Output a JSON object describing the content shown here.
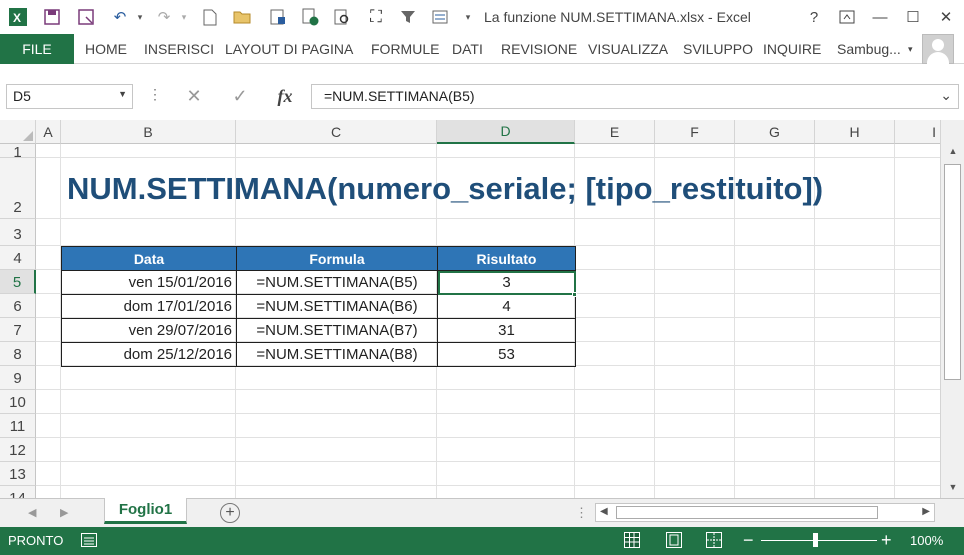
{
  "window": {
    "title": "La funzione NUM.SETTIMANA.xlsx - Excel",
    "help": "?",
    "minimize": "—",
    "restore": "☐",
    "close": "✕"
  },
  "quick_access": {
    "dropdown": "▾"
  },
  "ribbon": {
    "file_tab": "FILE",
    "tabs": [
      "HOME",
      "INSERISCI",
      "LAYOUT DI PAGINA",
      "FORMULE",
      "DATI",
      "REVISIONE",
      "VISUALIZZA",
      "SVILUPPO",
      "INQUIRE"
    ],
    "user": "Sambug...",
    "user_dropdown": "▾"
  },
  "formula_bar": {
    "name_box": "D5",
    "fx_label": "fx",
    "formula": "=NUM.SETTIMANA(B5)"
  },
  "grid": {
    "columns": [
      "A",
      "B",
      "C",
      "D",
      "E",
      "F",
      "G",
      "H",
      "I"
    ],
    "rows": [
      "1",
      "2",
      "3",
      "4",
      "5",
      "6",
      "7",
      "8",
      "9",
      "10",
      "11",
      "12",
      "13",
      "14"
    ],
    "selected_col": "D",
    "selected_row": "5"
  },
  "sheet": {
    "title": "NUM.SETTIMANA(numero_seriale; [tipo_restituito])",
    "table": {
      "headers": [
        "Data",
        "Formula",
        "Risultato"
      ],
      "rows": [
        {
          "data": "ven 15/01/2016",
          "formula": "=NUM.SETTIMANA(B5)",
          "risultato": "3"
        },
        {
          "data": "dom 17/01/2016",
          "formula": "=NUM.SETTIMANA(B6)",
          "risultato": "4"
        },
        {
          "data": "ven 29/07/2016",
          "formula": "=NUM.SETTIMANA(B7)",
          "risultato": "31"
        },
        {
          "data": "dom 25/12/2016",
          "formula": "=NUM.SETTIMANA(B8)",
          "risultato": "53"
        }
      ]
    }
  },
  "tabs_bar": {
    "sheet_name": "Foglio1",
    "add_sheet": "+"
  },
  "status": {
    "text": "PRONTO",
    "zoom": "100%",
    "zoom_minus": "−",
    "zoom_plus": "+"
  },
  "colors": {
    "excel_green": "#217346",
    "header_blue": "#2e75b6",
    "title_blue": "#1f4e79"
  }
}
